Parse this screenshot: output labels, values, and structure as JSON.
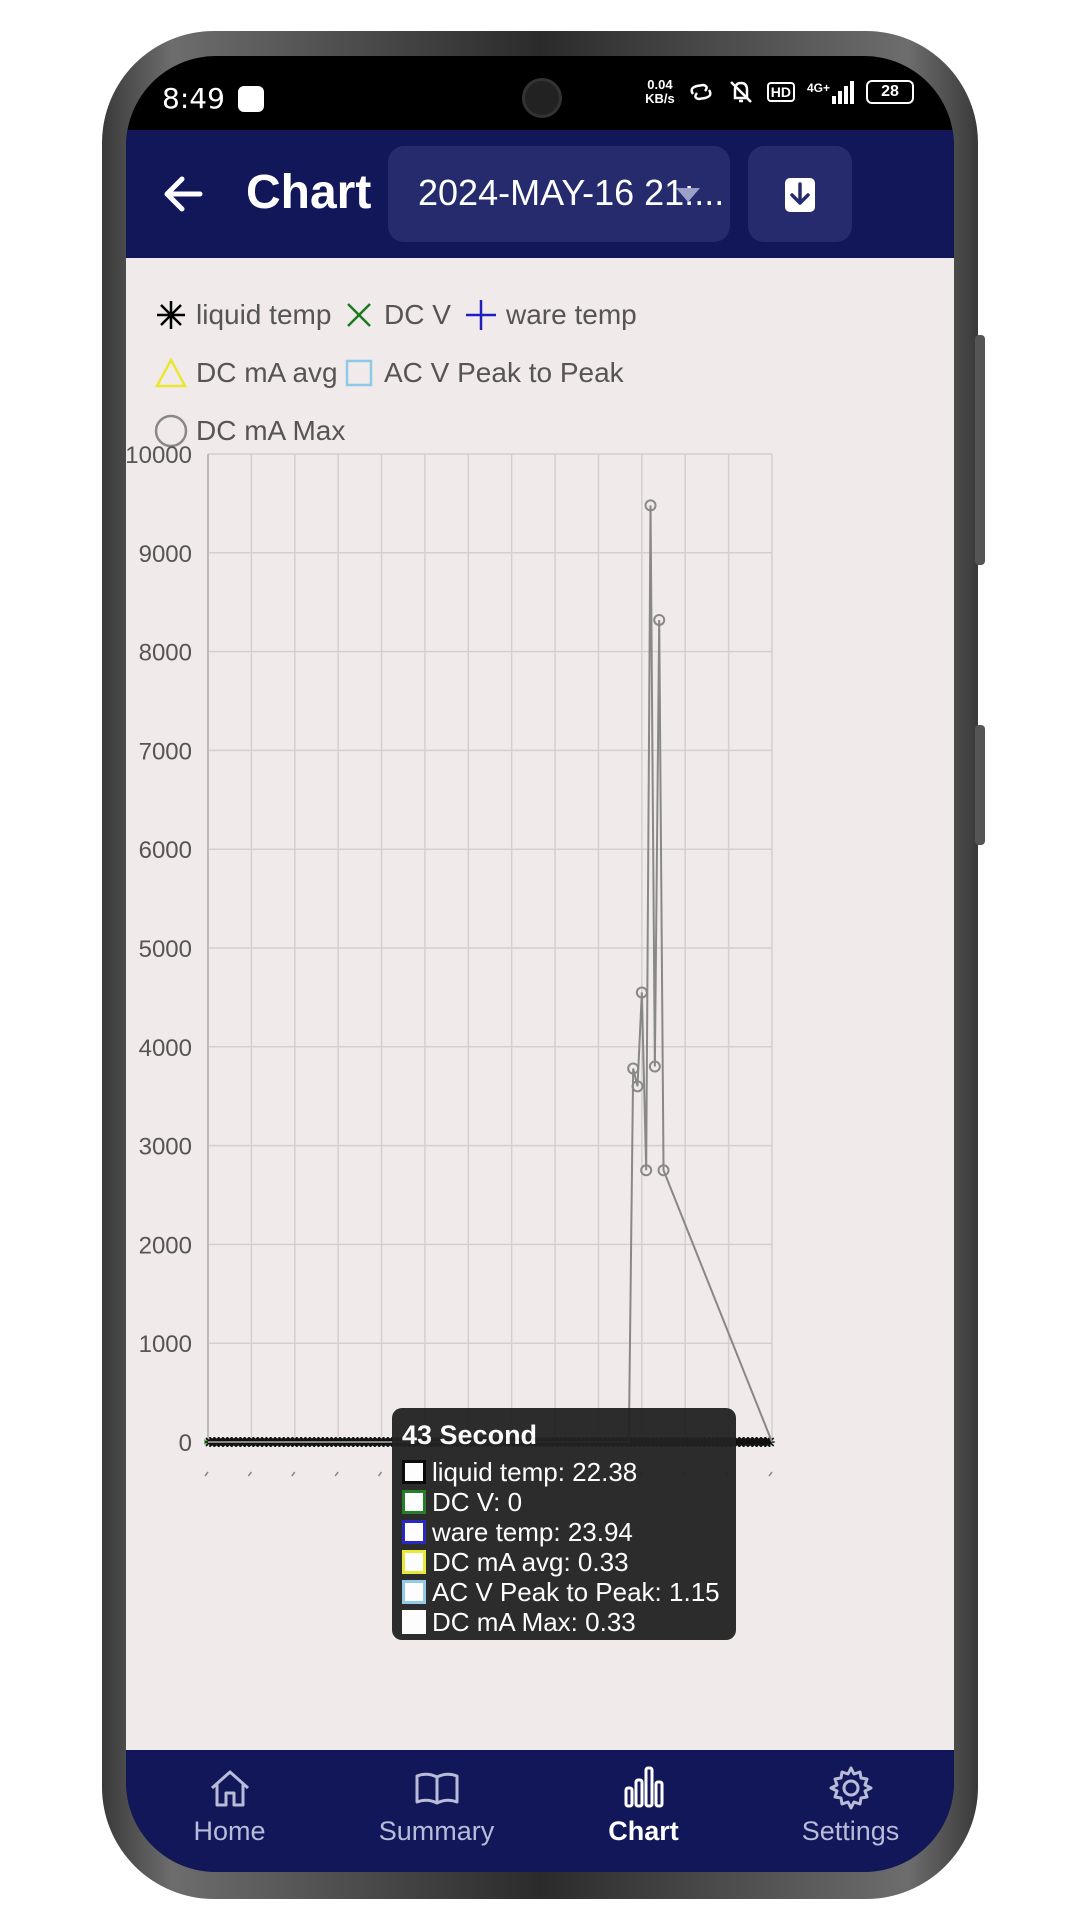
{
  "status": {
    "time": "8:49",
    "net_speed_value": "0.04",
    "net_speed_unit": "KB/s",
    "hd": "HD",
    "network": "4G+",
    "battery": "28"
  },
  "appbar": {
    "title": "Chart",
    "session_value": "2024-MAY-16 21:..."
  },
  "legend": [
    {
      "name": "liquid temp",
      "color": "#000000",
      "marker": "asterisk"
    },
    {
      "name": "DC V",
      "color": "#1c7a1c",
      "marker": "x"
    },
    {
      "name": "ware temp",
      "color": "#1f1fbf",
      "marker": "plus"
    },
    {
      "name": "DC mA avg",
      "color": "#e8e830",
      "marker": "triangle"
    },
    {
      "name": "AC V Peak to Peak",
      "color": "#8ec9e8",
      "marker": "square"
    },
    {
      "name": "DC mA Max",
      "color": "#888888",
      "marker": "circle"
    }
  ],
  "chart_data": {
    "type": "line",
    "ylim": [
      0,
      10000
    ],
    "y_ticks": [
      "10000",
      "9000",
      "8000",
      "7000",
      "6000",
      "5000",
      "4000",
      "3000",
      "2000",
      "1000",
      "0"
    ],
    "grid": true,
    "legend_position": "top-left",
    "series": [
      {
        "name": "DC mA Max",
        "color": "#888888",
        "x_index": [
          0,
          97,
          98,
          99,
          100,
          101,
          102,
          103,
          104,
          105,
          130
        ],
        "values": [
          0,
          0,
          3780,
          3600,
          4550,
          2750,
          9480,
          3800,
          8320,
          2750,
          0
        ]
      }
    ],
    "point_count": 130
  },
  "tooltip": {
    "title": "43 Second",
    "rows": [
      {
        "label": "liquid temp: 22.38",
        "color": "#000000"
      },
      {
        "label": "DC V: 0",
        "color": "#1c7a1c"
      },
      {
        "label": "ware temp: 23.94",
        "color": "#1f1fbf"
      },
      {
        "label": "DC mA avg: 0.33",
        "color": "#e8e830"
      },
      {
        "label": "AC V Peak to Peak: 1.15",
        "color": "#8ec9e8"
      },
      {
        "label": "DC mA Max: 0.33",
        "color": "#ffffff"
      }
    ]
  },
  "nav": [
    {
      "label": "Home",
      "icon": "home-icon",
      "active": false
    },
    {
      "label": "Summary",
      "icon": "book-icon",
      "active": false
    },
    {
      "label": "Chart",
      "icon": "bar-chart-icon",
      "active": true
    },
    {
      "label": "Settings",
      "icon": "gear-icon",
      "active": false
    }
  ]
}
